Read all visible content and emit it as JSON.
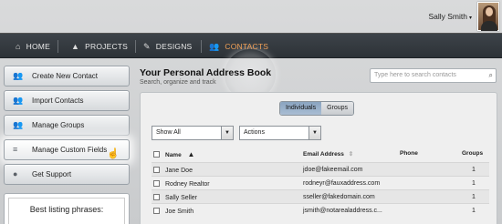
{
  "user": {
    "name": "Sally Smith",
    "caret": "▾"
  },
  "nav": {
    "items": [
      {
        "label": "HOME",
        "icon": "⌂"
      },
      {
        "label": "PROJECTS",
        "icon": "▲"
      },
      {
        "label": "DESIGNS",
        "icon": "✎"
      },
      {
        "label": "CONTACTS",
        "icon": "👥"
      }
    ],
    "active": "CONTACTS",
    "active_color": "#f0a057"
  },
  "sidebar": {
    "items": [
      {
        "label": "Create New Contact",
        "icon": "👥"
      },
      {
        "label": "Import Contacts",
        "icon": "👥"
      },
      {
        "label": "Manage Groups",
        "icon": "👥"
      },
      {
        "label": "Manage Custom Fields",
        "icon": "≡"
      },
      {
        "label": "Get Support",
        "icon": "●"
      }
    ],
    "promo_title": "Best listing phrases:"
  },
  "main": {
    "title": "Your Personal Address Book",
    "subtitle": "Search, organize and track",
    "search_placeholder": "Type here to search contacts",
    "toggle": {
      "individuals": "Individuals",
      "groups": "Groups"
    },
    "filter_select": "Show All",
    "actions_select": "Actions",
    "columns": {
      "name": "Name",
      "sort_arrow": "▲",
      "email": "Email Address",
      "phone": "Phone",
      "groups": "Groups"
    },
    "rows": [
      {
        "name": "Jane Doe",
        "email": "jdoe@fakeemail.com",
        "phone": "",
        "groups": "1"
      },
      {
        "name": "Rodney Realtor",
        "email": "rodneyr@fauxaddress.com",
        "phone": "",
        "groups": "1"
      },
      {
        "name": "Sally Seller",
        "email": "sseller@fakedomain.com",
        "phone": "",
        "groups": "1"
      },
      {
        "name": "Joe Smith",
        "email": "jsmith@notarealaddress.c...",
        "phone": "",
        "groups": "1"
      }
    ]
  }
}
